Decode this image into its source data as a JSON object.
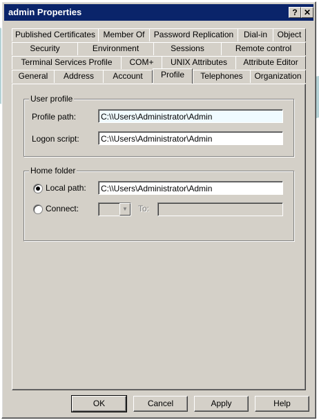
{
  "window": {
    "title": "admin Properties",
    "help_glyph": "?",
    "close_glyph": "✕"
  },
  "tabs": {
    "row1": [
      "Published Certificates",
      "Member Of",
      "Password Replication",
      "Dial-in",
      "Object"
    ],
    "row2": [
      "Security",
      "Environment",
      "Sessions",
      "Remote control"
    ],
    "row3": [
      "Terminal Services Profile",
      "COM+",
      "UNIX Attributes",
      "Attribute Editor"
    ],
    "row4": [
      "General",
      "Address",
      "Account",
      "Profile",
      "Telephones",
      "Organization"
    ],
    "active": "Profile"
  },
  "user_profile": {
    "legend": "User profile",
    "profile_path_label": "Profile path:",
    "profile_path_value": "C:\\\\Users\\Administrator\\Admin",
    "logon_script_label": "Logon script:",
    "logon_script_value": "C:\\\\Users\\Administrator\\Admin"
  },
  "home_folder": {
    "legend": "Home folder",
    "local_path_label": "Local path:",
    "local_path_value": "C:\\\\Users\\Administrator\\Admin",
    "connect_label": "Connect:",
    "to_label": "To:",
    "selected": "local_path"
  },
  "buttons": {
    "ok": "OK",
    "cancel": "Cancel",
    "apply": "Apply",
    "help": "Help"
  }
}
